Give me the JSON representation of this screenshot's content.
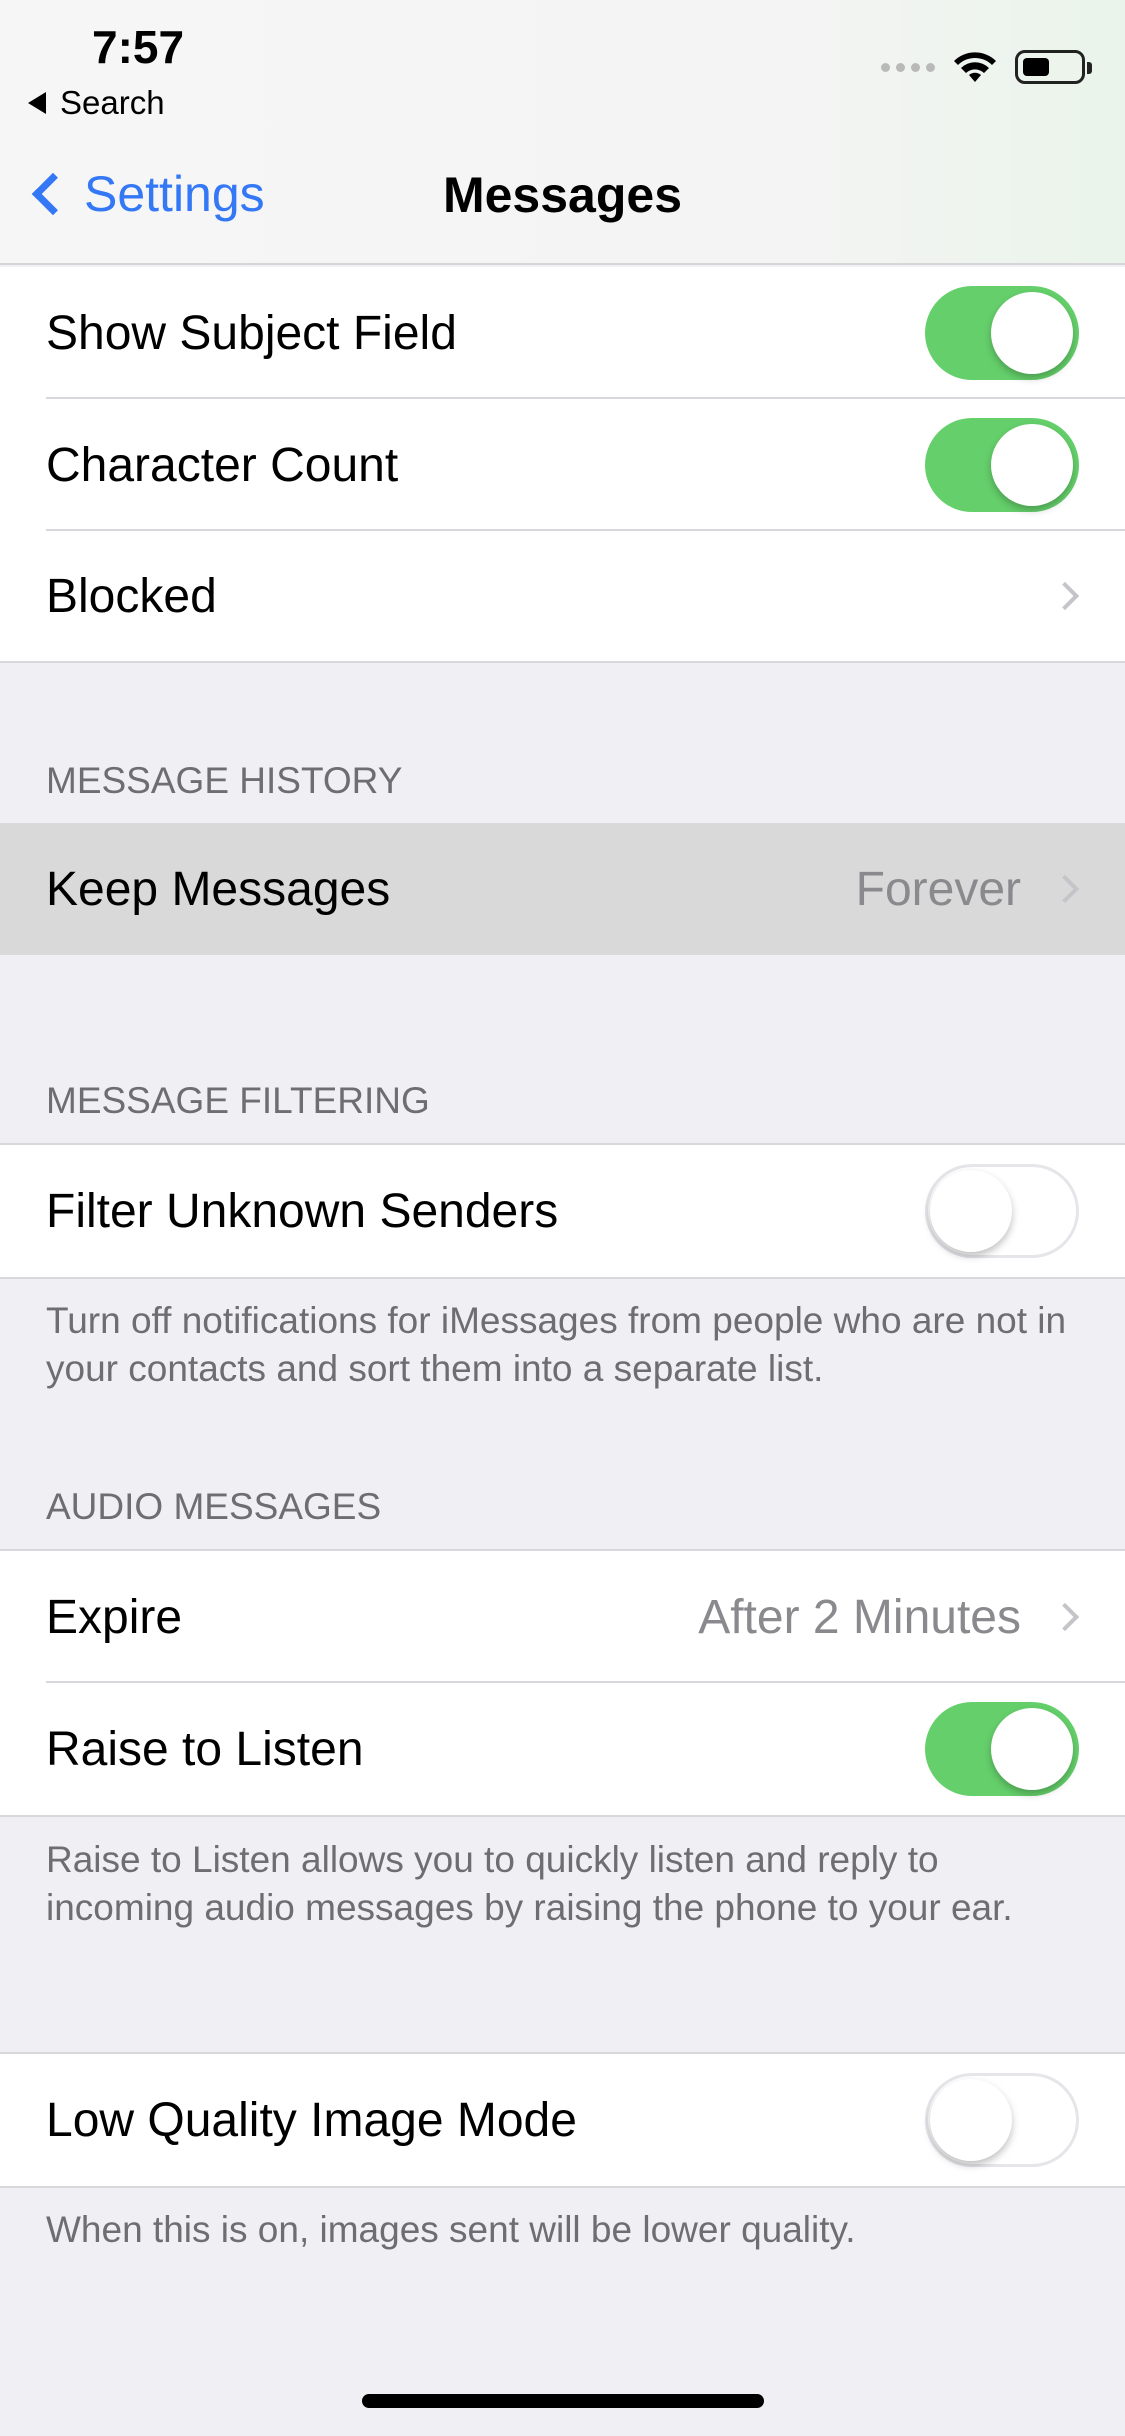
{
  "status": {
    "time": "7:57",
    "back_app": "Search"
  },
  "nav": {
    "back_label": "Settings",
    "title": "Messages"
  },
  "rows": {
    "show_subject_field": {
      "label": "Show Subject Field",
      "on": true
    },
    "character_count": {
      "label": "Character Count",
      "on": true
    },
    "blocked": {
      "label": "Blocked"
    },
    "keep_messages": {
      "label": "Keep Messages",
      "value": "Forever"
    },
    "filter_unknown": {
      "label": "Filter Unknown Senders",
      "on": false
    },
    "expire": {
      "label": "Expire",
      "value": "After 2 Minutes"
    },
    "raise_to_listen": {
      "label": "Raise to Listen",
      "on": true
    },
    "low_quality": {
      "label": "Low Quality Image Mode",
      "on": false
    }
  },
  "headers": {
    "message_history": "MESSAGE HISTORY",
    "message_filtering": "MESSAGE FILTERING",
    "audio_messages": "AUDIO MESSAGES"
  },
  "footers": {
    "filtering": "Turn off notifications for iMessages from people who are not in your contacts and sort them into a separate list.",
    "raise": "Raise to Listen allows you to quickly listen and reply to incoming audio messages by raising the phone to your ear.",
    "low_quality": "When this is on, images sent will be lower quality."
  },
  "colors": {
    "accent": "#3478f6",
    "switch_on": "#65d06b",
    "background": "#efeff4"
  },
  "icons": [
    "chevron-left-icon",
    "chevron-right-icon",
    "wifi-icon",
    "battery-icon",
    "signal-icon"
  ]
}
